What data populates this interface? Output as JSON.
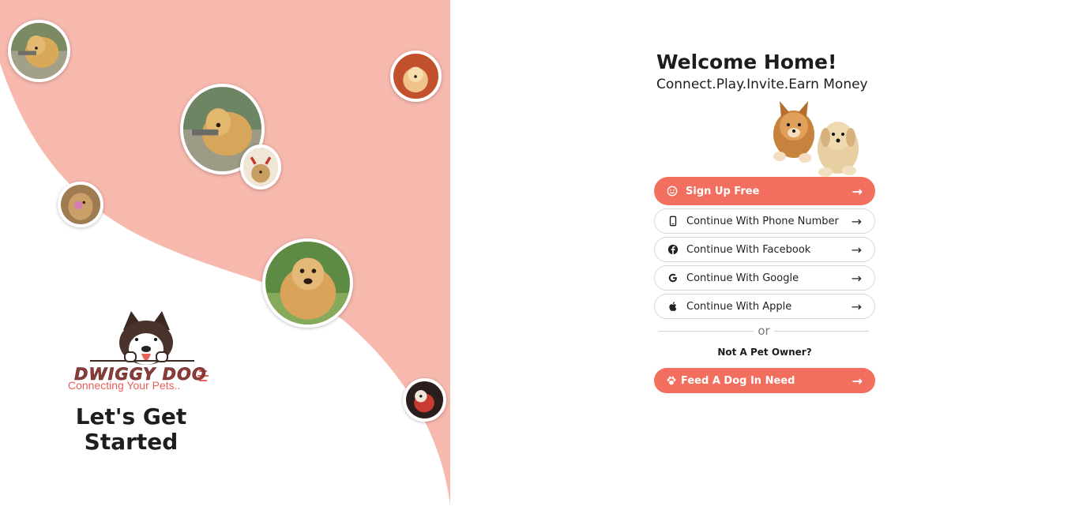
{
  "brand": {
    "name": "DWIGGY DOO",
    "tagline": "Connecting Your Pets.."
  },
  "left": {
    "headline": "Let's Get Started"
  },
  "welcome": {
    "title": "Welcome Home!",
    "subtitle": "Connect.Play.Invite.Earn Money"
  },
  "auth": {
    "signup_label": "Sign Up Free",
    "phone_label": "Continue With Phone Number",
    "facebook_label": "Continue With Facebook",
    "google_label": "Continue With Google",
    "apple_label": "Continue With Apple",
    "or_text": "or",
    "not_owner_text": "Not A Pet Owner?",
    "feed_label": "Feed A Dog In Need",
    "arrow": "→"
  },
  "colors": {
    "accent": "#f26f5f",
    "wave": "#f7b8ae",
    "text_dark": "#1c1c1c"
  },
  "icons": [
    "smiley-icon",
    "phone-icon",
    "facebook-icon",
    "google-icon",
    "apple-icon",
    "paw-icon",
    "arrow-right-icon"
  ]
}
